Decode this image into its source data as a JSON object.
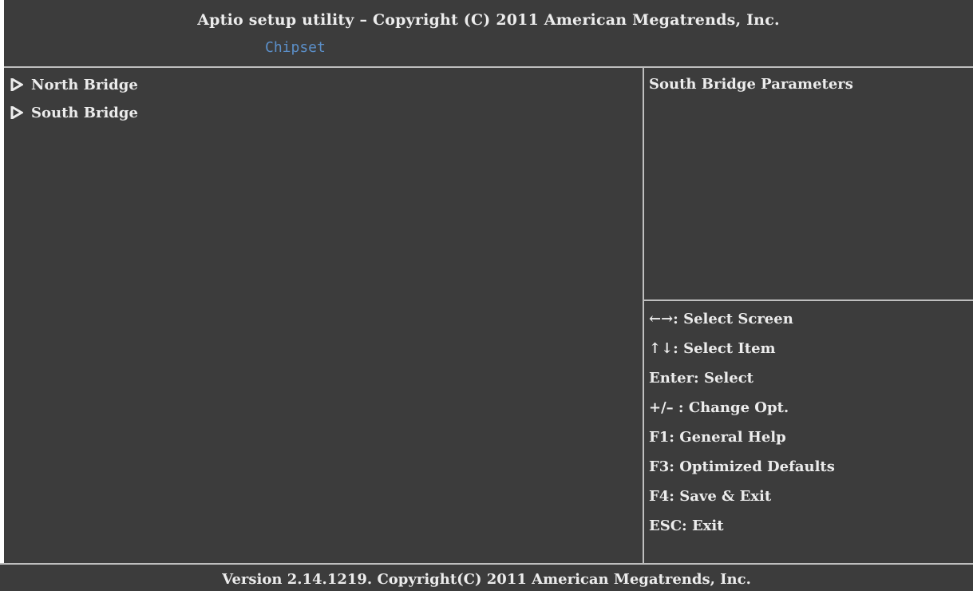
{
  "header": {
    "title": "Aptio setup utility – Copyright (C) 2011 American Megatrends, Inc.",
    "active_tab": "Chipset"
  },
  "menu": {
    "items": [
      {
        "label": "North Bridge",
        "icon": "triangle-right-icon"
      },
      {
        "label": "South Bridge",
        "icon": "triangle-right-icon"
      }
    ]
  },
  "help": {
    "description": "South Bridge Parameters",
    "keys": [
      "←→: Select Screen",
      "↑↓: Select Item",
      "Enter: Select",
      "+/– : Change Opt.",
      "F1: General Help",
      "F3: Optimized Defaults",
      "F4: Save & Exit",
      "ESC: Exit"
    ]
  },
  "footer": {
    "text": "Version 2.14.1219. Copyright(C) 2011 American Megatrends, Inc."
  },
  "colors": {
    "background": "#3c3c3c",
    "text": "#ececec",
    "active_tab": "#5b8fc9",
    "divider": "#bfbfbf"
  }
}
